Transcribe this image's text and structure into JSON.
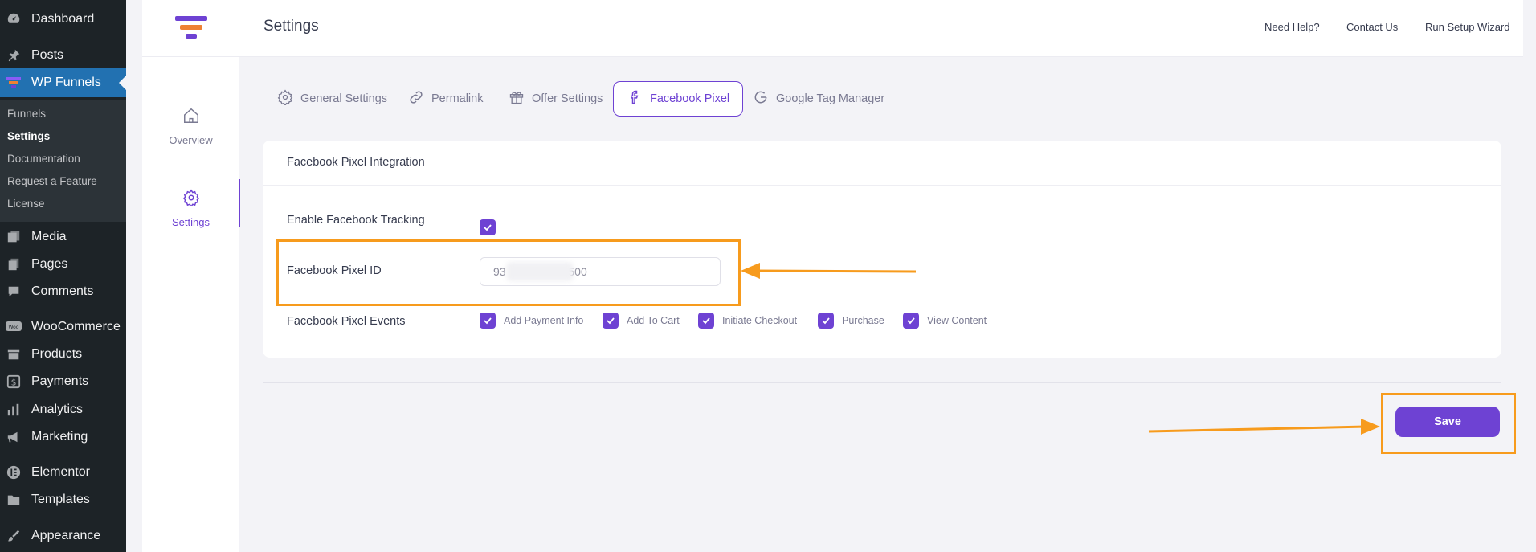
{
  "wp_menu": {
    "items": [
      {
        "label": "Dashboard",
        "icon": "dashboard-icon"
      },
      {
        "label": "Posts",
        "icon": "pushpin-icon"
      },
      {
        "label": "WP Funnels",
        "icon": "funnel-icon"
      },
      {
        "label": "Media",
        "icon": "media-icon"
      },
      {
        "label": "Pages",
        "icon": "pages-icon"
      },
      {
        "label": "Comments",
        "icon": "comment-icon"
      },
      {
        "label": "WooCommerce",
        "icon": "woo-icon"
      },
      {
        "label": "Products",
        "icon": "archive-icon"
      },
      {
        "label": "Payments",
        "icon": "dollar-icon"
      },
      {
        "label": "Analytics",
        "icon": "bar-chart-icon"
      },
      {
        "label": "Marketing",
        "icon": "megaphone-icon"
      },
      {
        "label": "Elementor",
        "icon": "elementor-icon"
      },
      {
        "label": "Templates",
        "icon": "folder-icon"
      },
      {
        "label": "Appearance",
        "icon": "paintbrush-icon"
      }
    ],
    "submenu": [
      "Funnels",
      "Settings",
      "Documentation",
      "Request a Feature",
      "License"
    ]
  },
  "plugin_nav": {
    "overview": "Overview",
    "settings": "Settings"
  },
  "header": {
    "title": "Settings",
    "links": [
      "Need Help?",
      "Contact Us",
      "Run Setup Wizard"
    ]
  },
  "tabs": [
    "General Settings",
    "Permalink",
    "Offer Settings",
    "Facebook Pixel",
    "Google Tag Manager"
  ],
  "card": {
    "title": "Facebook Pixel Integration",
    "enable_label": "Enable Facebook Tracking",
    "enable_checked": true,
    "pixel_id_label": "Facebook Pixel ID",
    "pixel_id_value": "93                    500",
    "events_label": "Facebook Pixel Events",
    "events": [
      "Add Payment Info",
      "Add To Cart",
      "Initiate Checkout",
      "Purchase",
      "View Content"
    ]
  },
  "save_label": "Save",
  "colors": {
    "brand": "#6e42d3",
    "annotation": "#f79b1d",
    "wp_sidebar": "#1d2327",
    "wp_active": "#2271b1"
  }
}
